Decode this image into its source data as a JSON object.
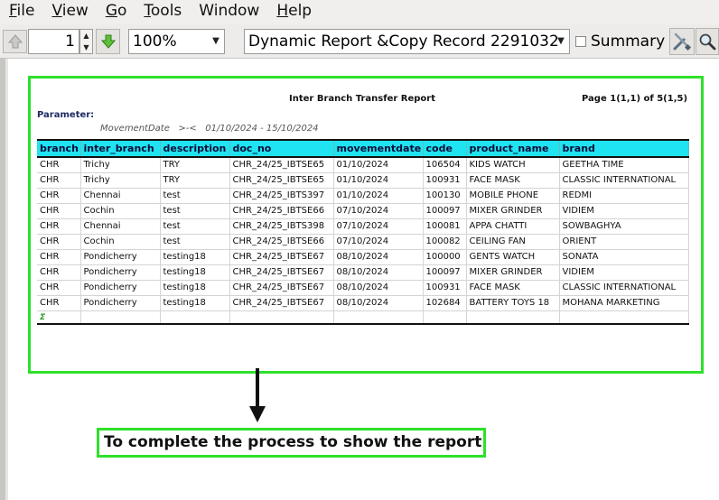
{
  "menu": {
    "items": [
      {
        "key": "F",
        "rest": "ile"
      },
      {
        "key": "V",
        "rest": "iew"
      },
      {
        "key": "G",
        "rest": "o"
      },
      {
        "key": "T",
        "rest": "ools"
      },
      {
        "key": "",
        "rest": "Window"
      },
      {
        "key": "H",
        "rest": "elp"
      }
    ]
  },
  "toolbar": {
    "page_number": "1",
    "zoom": "100%",
    "report_name": "Dynamic Report &Copy Record 2291032",
    "summary_label": "Summary",
    "summary_checked": false
  },
  "report": {
    "title": "Inter Branch Transfer Report",
    "page_info": "Page 1(1,1) of 5(1,5)",
    "parameter_label": "Parameter:",
    "parameter_value": "MovementDate   >-<   01/10/2024 - 15/10/2024",
    "columns": [
      "branch",
      "inter_branch",
      "description",
      "doc_no",
      "movementdate",
      "code",
      "product_name",
      "brand"
    ],
    "rows": [
      [
        "CHR",
        "Trichy",
        "TRY",
        "CHR_24/25_IBTSE65",
        "01/10/2024",
        "106504",
        "KIDS WATCH",
        "GEETHA TIME"
      ],
      [
        "CHR",
        "Trichy",
        "TRY",
        "CHR_24/25_IBTSE65",
        "01/10/2024",
        "100931",
        "FACE MASK",
        "CLASSIC INTERNATIONAL"
      ],
      [
        "CHR",
        "Chennai",
        "test",
        "CHR_24/25_IBTS397",
        "01/10/2024",
        "100130",
        "MOBILE PHONE",
        "REDMI"
      ],
      [
        "CHR",
        "Cochin",
        "test",
        "CHR_24/25_IBTSE66",
        "07/10/2024",
        "100097",
        "MIXER GRINDER",
        "VIDIEM"
      ],
      [
        "CHR",
        "Chennai",
        "test",
        "CHR_24/25_IBTS398",
        "07/10/2024",
        "100081",
        "APPA CHATTI",
        "SOWBAGHYA"
      ],
      [
        "CHR",
        "Cochin",
        "test",
        "CHR_24/25_IBTSE66",
        "07/10/2024",
        "100082",
        "CEILING FAN",
        "ORIENT"
      ],
      [
        "CHR",
        "Pondicherry",
        "testing18",
        "CHR_24/25_IBTSE67",
        "08/10/2024",
        "100000",
        "GENTS WATCH",
        "SONATA"
      ],
      [
        "CHR",
        "Pondicherry",
        "testing18",
        "CHR_24/25_IBTSE67",
        "08/10/2024",
        "100097",
        "MIXER GRINDER",
        "VIDIEM"
      ],
      [
        "CHR",
        "Pondicherry",
        "testing18",
        "CHR_24/25_IBTSE67",
        "08/10/2024",
        "100931",
        "FACE MASK",
        "CLASSIC INTERNATIONAL"
      ],
      [
        "CHR",
        "Pondicherry",
        "testing18",
        "CHR_24/25_IBTSE67",
        "08/10/2024",
        "102684",
        "BATTERY TOYS 18",
        "MOHANA MARKETING"
      ]
    ],
    "total_marker": "Σ"
  },
  "annotation": {
    "callout_text": "To complete the process to show the report",
    "highlight_color": "#2fe02b"
  }
}
